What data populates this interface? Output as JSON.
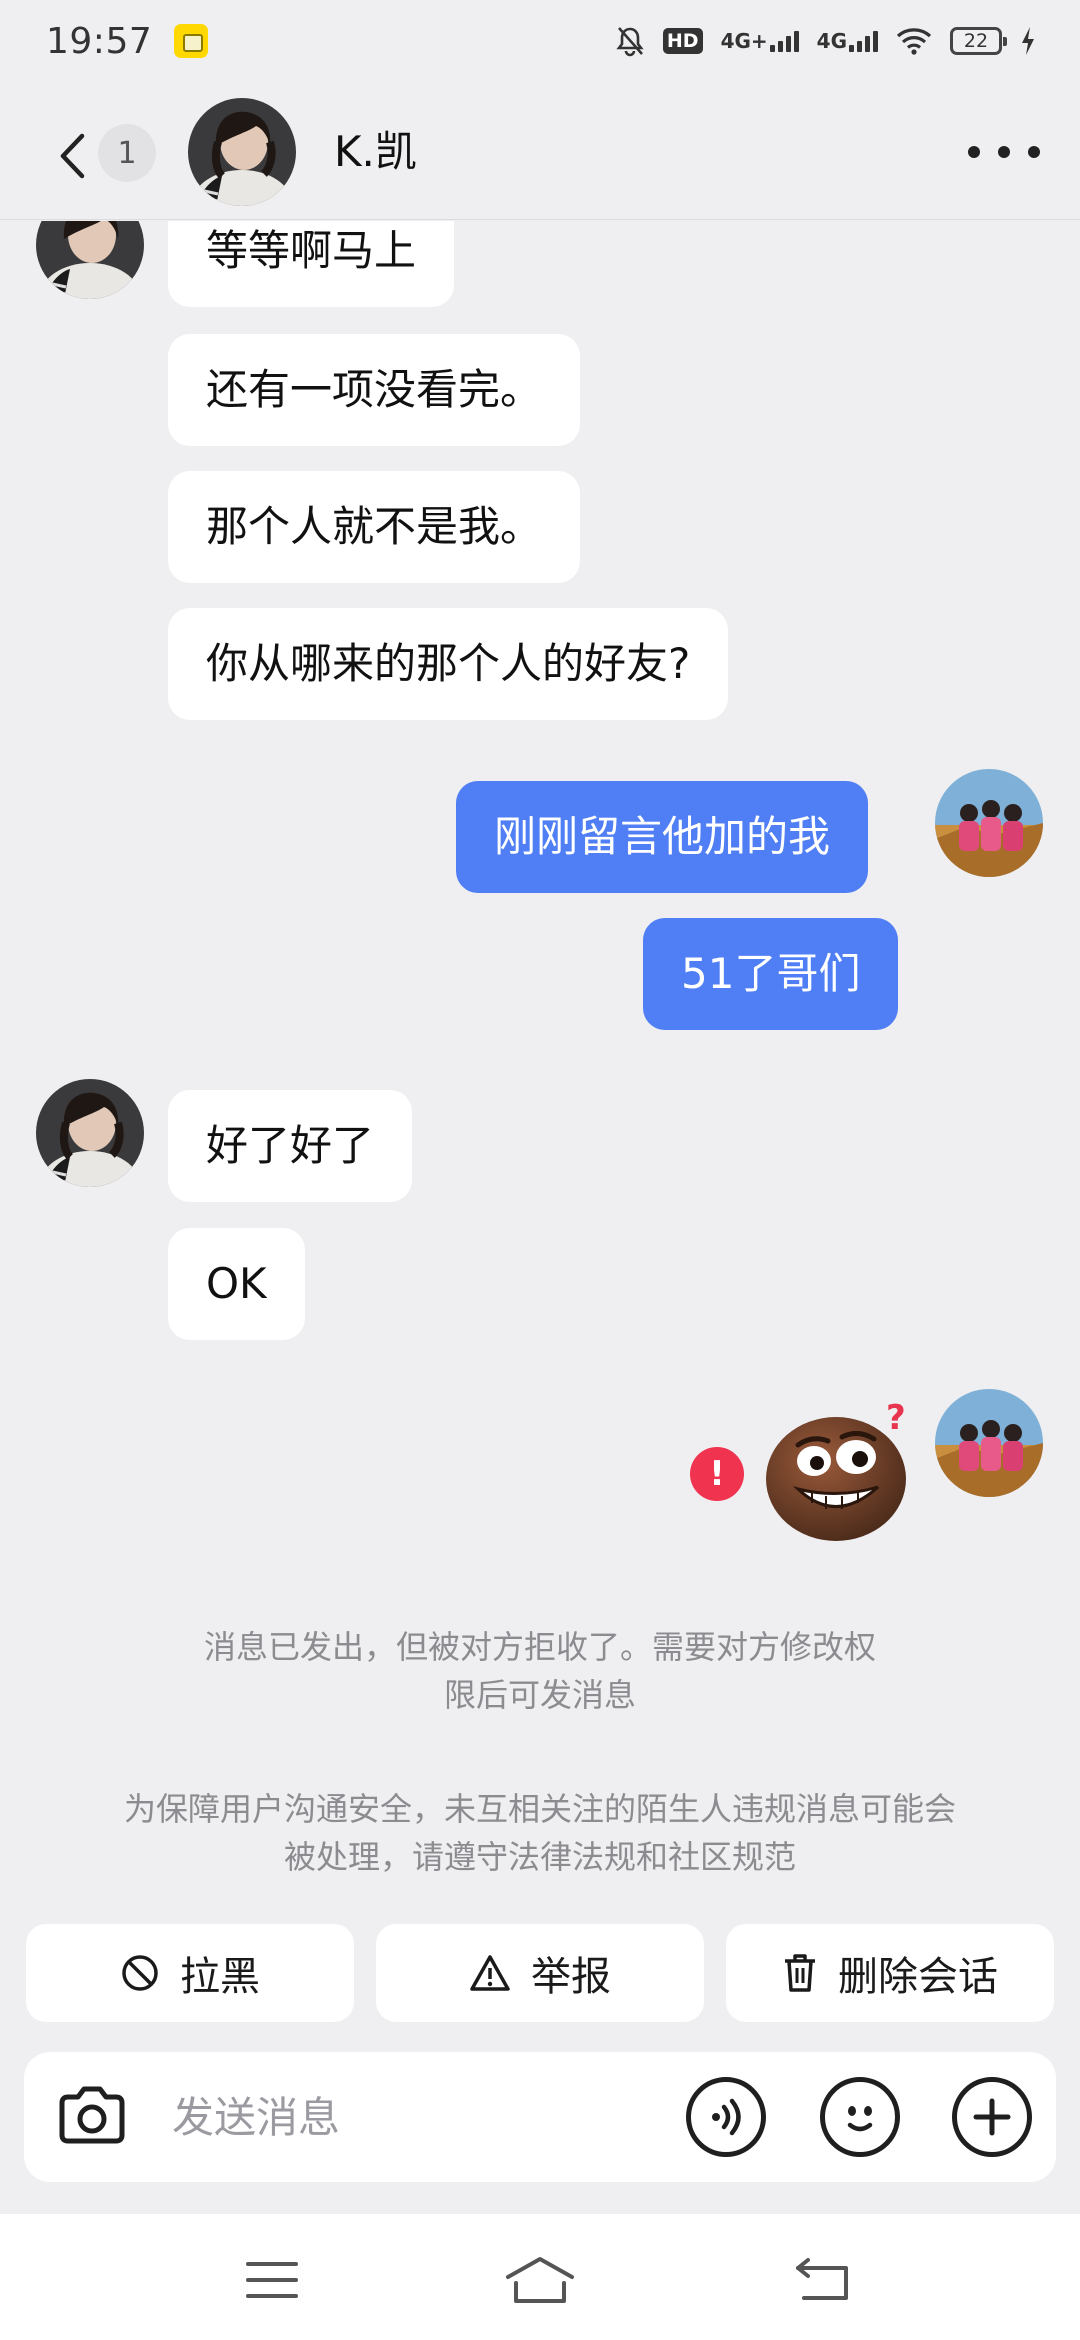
{
  "status_bar": {
    "time": "19:57",
    "hd_label": "HD",
    "network_1": "4G+",
    "network_2": "4G",
    "battery": "22"
  },
  "header": {
    "unread_count": "1",
    "contact_name": "K.凯"
  },
  "messages": [
    {
      "side": "in",
      "text": "等等啊马上"
    },
    {
      "side": "in",
      "text": "还有一项没看完。"
    },
    {
      "side": "in",
      "text": "那个人就不是我。"
    },
    {
      "side": "in",
      "text": "你从哪来的那个人的好友?"
    },
    {
      "side": "out",
      "text": "刚刚留言他加的我"
    },
    {
      "side": "out",
      "text": "51了哥们"
    },
    {
      "side": "in",
      "text": "好了好了"
    },
    {
      "side": "in",
      "text": "OK"
    },
    {
      "side": "out",
      "type": "sticker",
      "status": "failed",
      "error_mark": "!"
    }
  ],
  "system_notes": {
    "rejected": "消息已发出，但被对方拒收了。需要对方修改权限后可发消息",
    "safety": "为保障用户沟通安全，未互相关注的陌生人违规消息可能会被处理，请遵守法律法规和社区规范"
  },
  "actions": {
    "block": "拉黑",
    "report": "举报",
    "delete": "删除会话"
  },
  "input": {
    "placeholder": "发送消息"
  },
  "colors": {
    "outgoing_bubble": "#4f7ef5",
    "incoming_bubble": "#ffffff",
    "background": "#efeff1",
    "error": "#f0334f"
  }
}
